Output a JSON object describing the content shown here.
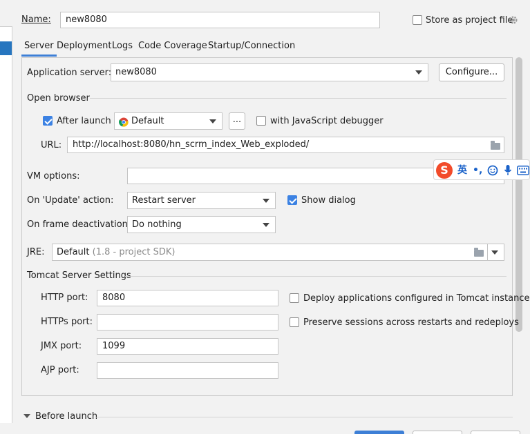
{
  "header": {
    "name_label": "Name:",
    "name_value": "new8080",
    "store_label": "Store as project file",
    "store_checked": false
  },
  "tabs": [
    {
      "label": "Server",
      "active": true
    },
    {
      "label": "Deployment"
    },
    {
      "label": "Logs"
    },
    {
      "label": "Code Coverage"
    },
    {
      "label": "Startup/Connection"
    }
  ],
  "server": {
    "app_server_label": "Application server:",
    "app_server_value": "new8080",
    "configure_label": "Configure...",
    "open_browser_label": "Open browser",
    "after_launch_label": "After launch",
    "after_launch_checked": true,
    "browser_value": "Default",
    "ellipsis_label": "...",
    "js_debugger_label": "with JavaScript debugger",
    "js_debugger_checked": false,
    "url_label": "URL:",
    "url_value": "http://localhost:8080/hn_scrm_index_Web_exploded/",
    "vm_options_label": "VM options:",
    "vm_options_value": "",
    "on_update_label": "On 'Update' action:",
    "on_update_value": "Restart server",
    "show_dialog_label": "Show dialog",
    "show_dialog_checked": true,
    "on_frame_label": "On frame deactivation:",
    "on_frame_value": "Do nothing",
    "jre_label": "JRE:",
    "jre_value": "Default",
    "jre_hint": "(1.8 - project SDK)"
  },
  "tomcat": {
    "section_label": "Tomcat Server Settings",
    "http_port_label": "HTTP port:",
    "http_port_value": "8080",
    "https_port_label": "HTTPs port:",
    "https_port_value": "",
    "jmx_port_label": "JMX port:",
    "jmx_port_value": "1099",
    "ajp_port_label": "AJP port:",
    "ajp_port_value": "",
    "deploy_label": "Deploy applications configured in Tomcat instance",
    "deploy_checked": false,
    "preserve_label": "Preserve sessions across restarts and redeploys",
    "preserve_checked": false
  },
  "before_launch": {
    "label": "Before launch"
  },
  "ime_toolbar": {
    "logo": "S",
    "lang": "英",
    "punct": "•,",
    "icons": [
      "emoji-icon",
      "microphone-icon",
      "keyboard-icon"
    ]
  },
  "colors": {
    "accent": "#3c82e3",
    "tab_underline": "#3d7fd6",
    "selection": "#2675bf",
    "ime_logo": "#f24b2a",
    "ime_icon": "#1a62c9"
  }
}
